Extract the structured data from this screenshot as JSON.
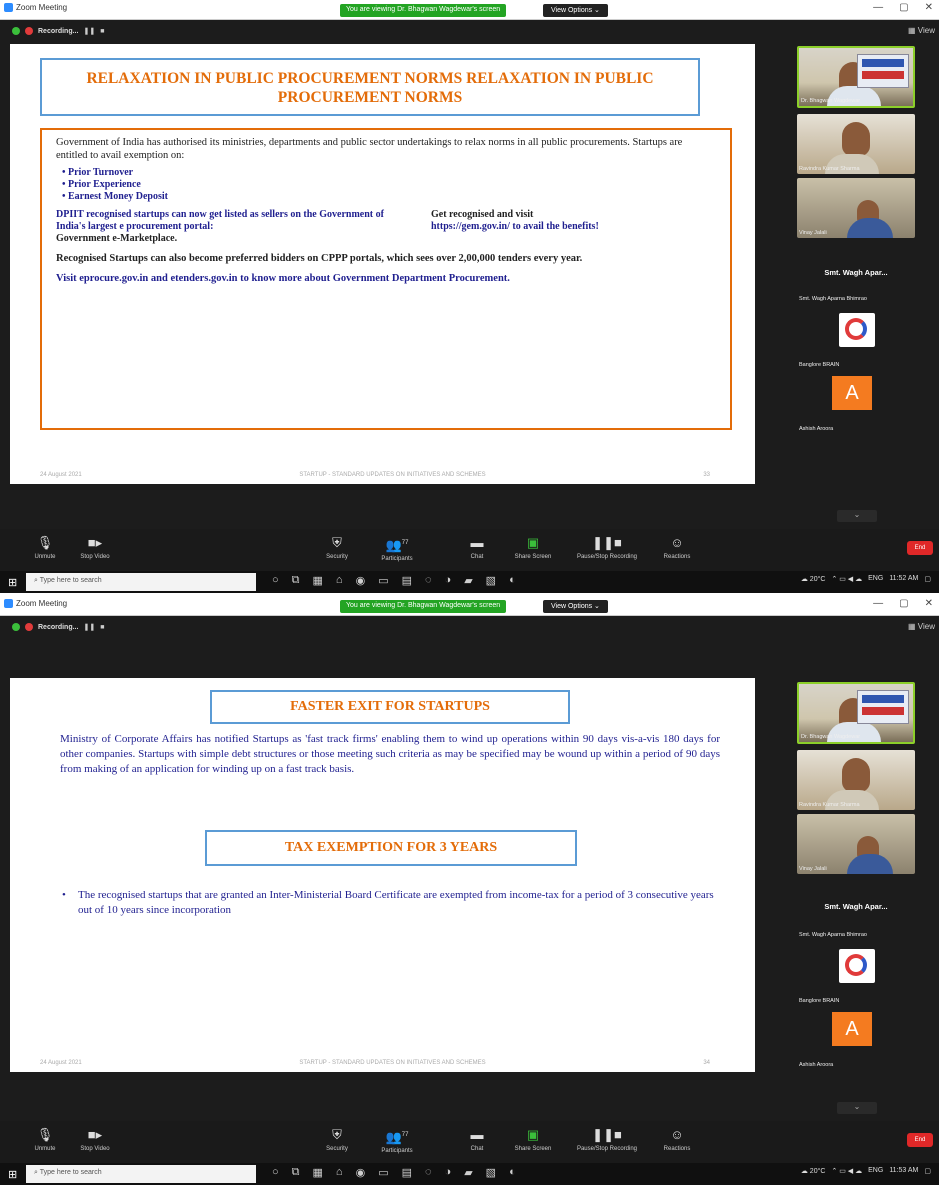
{
  "window": {
    "app_title": "Zoom Meeting",
    "viewing_notice": "You are viewing Dr. Bhagwan Wagdewar's screen",
    "view_options": "View Options ⌄",
    "recording": "Recording...",
    "view_label": "View",
    "controls": [
      "—",
      "▢",
      "✕"
    ]
  },
  "toolbar": {
    "unmute": "Unmute",
    "stop_video": "Stop Video",
    "security": "Security",
    "participants": "Participants",
    "participants_count": "77",
    "chat": "Chat",
    "share_screen": "Share Screen",
    "pause_recording": "Pause/Stop Recording",
    "reactions": "Reactions",
    "end": "End"
  },
  "taskbar": {
    "search_placeholder": "Type here to search",
    "weather": "20°C",
    "lang": "ENG",
    "time1": "11:52 AM",
    "time2": "11:53 AM",
    "date": "6/24/2021"
  },
  "participants": {
    "p1": "Dr. Bhagwan Wagdewar",
    "p2": "Ravindra Kumar Sharma",
    "p3": "Vinay Jalali",
    "p4_big": "Smt. Wagh Apar...",
    "p4": "Smt. Wagh Aparna Bhimrao",
    "p5": "Banglore BRAIN",
    "p6_letter": "A",
    "p6": "Ashish Aroora"
  },
  "slide1": {
    "title": "RELAXATION IN PUBLIC PROCUREMENT NORMS RELAXATION IN PUBLIC PROCUREMENT NORMS",
    "intro": "Government of India has authorised its ministries, departments and public sector undertakings  to relax norms in all public procurements. Startups are entitled to avail exemption on:",
    "bullets": [
      "• Prior Turnover",
      "• Prior Experience",
      "• Earnest Money Deposit"
    ],
    "left_col": "DPIIT recognised startups can now get listed as sellers on the Government of India's largest e procurement portal:",
    "left_col_end": "Government e-Marketplace.",
    "right_col": "Get recognised and visit",
    "right_col_link": "https://gem.gov.in/ to avail the benefits!",
    "cppp": "Recognised Startups can also become preferred bidders on CPPP portals, which sees  over 2,00,000 tenders every year.",
    "visit": "Visit eprocure.gov.in and etenders.gov.in to know more about Government Department Procurement.",
    "footer_date": "24 August 2021",
    "footer_mid": "STARTUP - STANDARD UPDATES ON INITIATIVES AND SCHEMES",
    "footer_page": "33"
  },
  "slide2": {
    "title1": "FASTER EXIT FOR STARTUPS",
    "para": "Ministry of Corporate Affairs has notified Startups as 'fast track firms' enabling them to wind up operations within 90 days vis-a-vis 180 days for other companies. Startups with simple debt structures or those meeting such criteria as may be specified may be wound up within a period of 90 days from making of an application for winding up on a fast track basis.",
    "title2": "TAX EXEMPTION FOR 3 YEARS",
    "bullet": "The recognised startups that are granted an Inter-Ministerial Board Certificate are  exempted from income-tax for a period of 3 consecutive years out of 10 years since incorporation",
    "footer_date": "24 August 2021",
    "footer_mid": "STARTUP - STANDARD UPDATES ON INITIATIVES AND SCHEMES",
    "footer_page": "34"
  },
  "colors": {
    "title_orange": "#e36c09",
    "box_blue": "#5b9bd5",
    "text_navy": "#1f1f8f",
    "zoom_green": "#23a423"
  }
}
